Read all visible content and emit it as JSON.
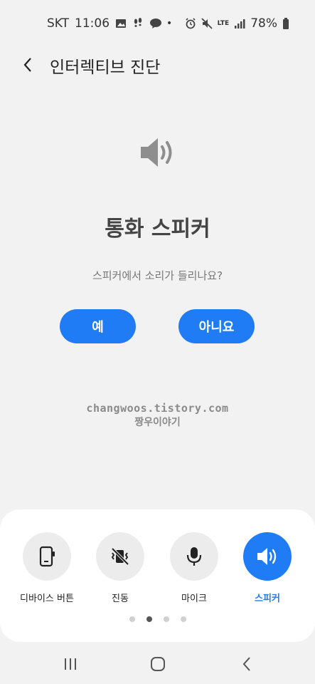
{
  "status_bar": {
    "carrier": "SKT",
    "time": "11:06",
    "network": "LTE",
    "battery": "78%"
  },
  "header": {
    "title": "인터렉티브 진단"
  },
  "test": {
    "title": "통화 스피커",
    "question": "스피커에서 소리가 들리나요?",
    "yes_label": "예",
    "no_label": "아니요"
  },
  "watermark": {
    "line1": "changwoos.tistory.com",
    "line2": "짱우이야기"
  },
  "test_items": [
    {
      "label": "디바이스 버튼",
      "icon": "device-button-icon",
      "active": false
    },
    {
      "label": "진동",
      "icon": "vibration-off-icon",
      "active": false
    },
    {
      "label": "마이크",
      "icon": "microphone-icon",
      "active": false
    },
    {
      "label": "스피커",
      "icon": "speaker-icon",
      "active": true
    }
  ],
  "pagination": {
    "count": 4,
    "active_index": 1
  },
  "colors": {
    "accent": "#1f7cf5",
    "background": "#f2f2f2",
    "card": "#ffffff",
    "circle": "#ececec"
  }
}
